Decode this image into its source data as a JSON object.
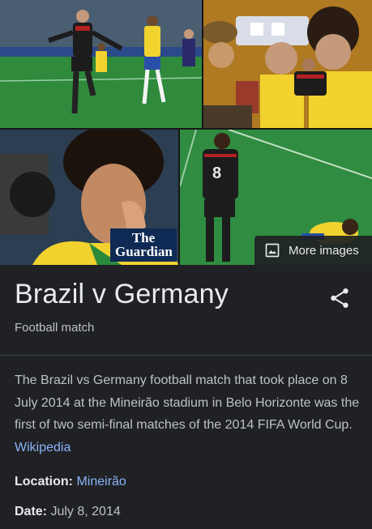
{
  "images": {
    "watermark": "The Guardian",
    "more_images_label": "More images",
    "more_images_icon": "image-icon"
  },
  "entity": {
    "title": "Brazil v Germany",
    "subtitle": "Football match",
    "share_icon": "share-icon"
  },
  "description": {
    "text": "The Brazil vs Germany football match that took place on 8 July 2014 at the Mineirão stadium in Belo Horizonte was the first of two semi-final matches of the 2014 FIFA World Cup.",
    "source_link": "Wikipedia"
  },
  "facts": [
    {
      "label": "Location:",
      "value": "Mineirão",
      "is_link": true
    },
    {
      "label": "Date:",
      "value": "July 8, 2014",
      "is_link": false
    }
  ],
  "colors": {
    "background": "#202124",
    "text_primary": "#e8eaed",
    "text_secondary": "#bdc1c6",
    "link": "#8ab4f8"
  }
}
